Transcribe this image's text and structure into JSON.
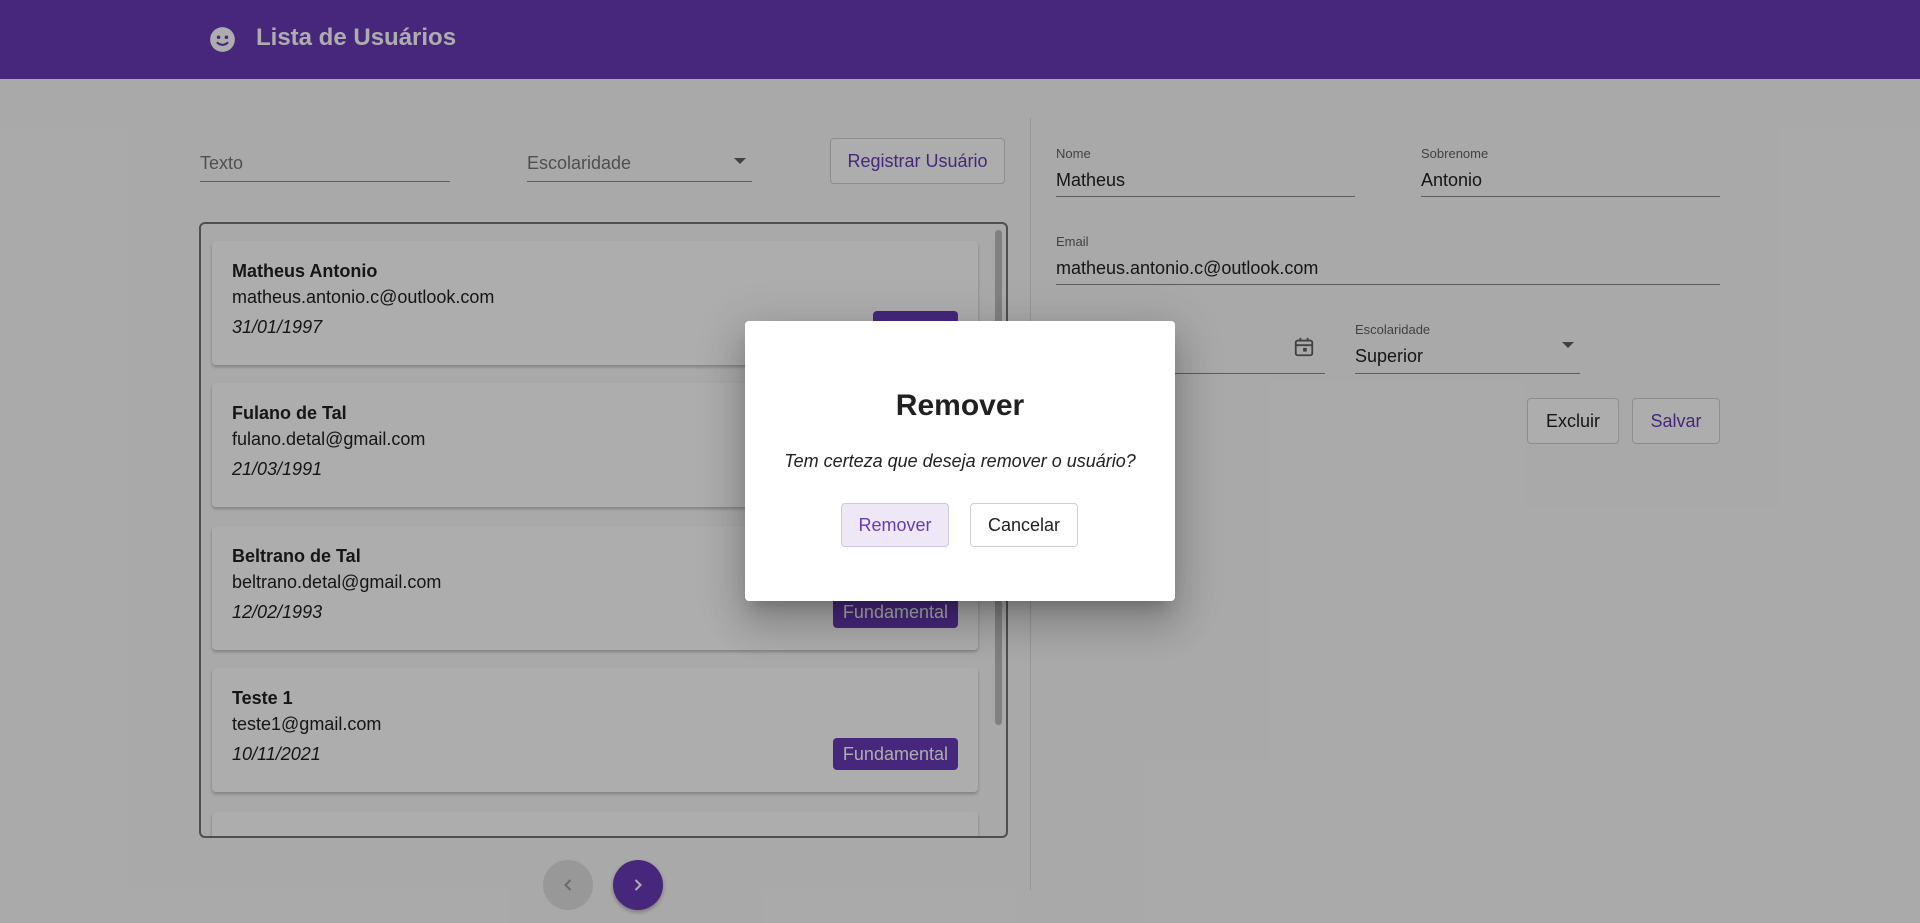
{
  "header": {
    "title": "Lista de Usuários",
    "logo_icon": "face-icon",
    "color": "#673ab7"
  },
  "filters": {
    "text_placeholder": "Texto",
    "select_label": "Escolaridade",
    "register_label": "Registrar Usuário"
  },
  "users": [
    {
      "name": "Matheus Antonio",
      "email": "matheus.antonio.c@outlook.com",
      "date": "31/01/1997",
      "level": ""
    },
    {
      "name": "Fulano de Tal",
      "email": "fulano.detal@gmail.com",
      "date": "21/03/1991",
      "level": ""
    },
    {
      "name": "Beltrano de Tal",
      "email": "beltrano.detal@gmail.com",
      "date": "12/02/1993",
      "level": "Fundamental"
    },
    {
      "name": "Teste 1",
      "email": "teste1@gmail.com",
      "date": "10/11/2021",
      "level": "Fundamental"
    }
  ],
  "form": {
    "nome_label": "Nome",
    "nome_value": "Matheus",
    "sobrenome_label": "Sobrenome",
    "sobrenome_value": "Antonio",
    "email_label": "Email",
    "email_value": "matheus.antonio.c@outlook.com",
    "escolaridade_label": "Escolaridade",
    "escolaridade_value": "Superior",
    "excluir_label": "Excluir",
    "salvar_label": "Salvar"
  },
  "dialog": {
    "title": "Remover",
    "message": "Tem certeza que deseja remover o usuário?",
    "confirm_label": "Remover",
    "cancel_label": "Cancelar"
  }
}
